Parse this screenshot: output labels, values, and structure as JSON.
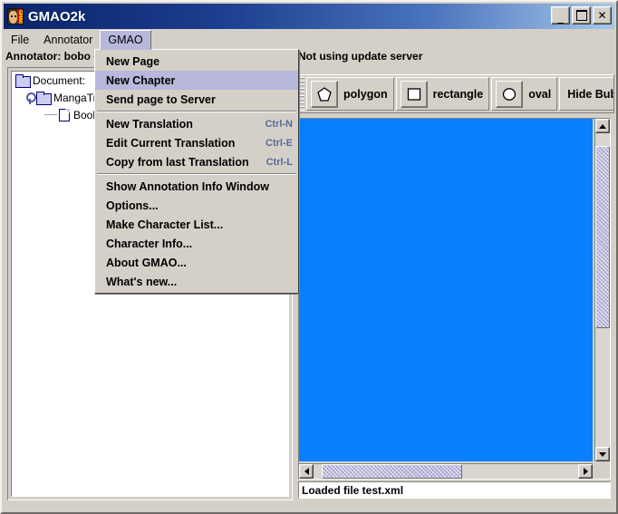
{
  "window": {
    "title": "GMAO2k",
    "icon": "gmao-app-icon",
    "controls": {
      "minimize": "_",
      "maximize": "□",
      "close": "✕"
    }
  },
  "menubar": {
    "items": [
      {
        "label": "File",
        "open": false
      },
      {
        "label": "Annotator",
        "open": false
      },
      {
        "label": "GMAO",
        "open": true
      }
    ]
  },
  "dropdown": {
    "owner": "GMAO",
    "items": [
      {
        "label": "New Page",
        "accel": "",
        "selected": false,
        "type": "item"
      },
      {
        "label": "New Chapter",
        "accel": "",
        "selected": true,
        "type": "item"
      },
      {
        "label": "Send page to Server",
        "accel": "",
        "selected": false,
        "type": "item"
      },
      {
        "type": "separator"
      },
      {
        "label": "New Translation",
        "accel": "Ctrl-N",
        "selected": false,
        "type": "item"
      },
      {
        "label": "Edit Current Translation",
        "accel": "Ctrl-E",
        "selected": false,
        "type": "item"
      },
      {
        "label": "Copy from last Translation",
        "accel": "Ctrl-L",
        "selected": false,
        "type": "item"
      },
      {
        "type": "separator"
      },
      {
        "label": "Show Annotation Info Window",
        "accel": "",
        "selected": false,
        "type": "item"
      },
      {
        "label": "Options...",
        "accel": "",
        "selected": false,
        "type": "item"
      },
      {
        "label": "Make Character List...",
        "accel": "",
        "selected": false,
        "type": "item"
      },
      {
        "label": "Character Info...",
        "accel": "",
        "selected": false,
        "type": "item"
      },
      {
        "label": "About GMAO...",
        "accel": "",
        "selected": false,
        "type": "item"
      },
      {
        "label": "What's new...",
        "accel": "",
        "selected": false,
        "type": "item"
      }
    ]
  },
  "annotator": {
    "text": "Annotator: bobo (b"
  },
  "update_server": {
    "text": "Not using update server"
  },
  "tree": {
    "rows": [
      {
        "label": "Document:",
        "icon": "folder-icon",
        "level": 0,
        "handle": "none"
      },
      {
        "label": "MangaTr",
        "icon": "folder-icon",
        "level": 1,
        "handle": "expanded"
      },
      {
        "label": "Book",
        "icon": "page-icon",
        "level": 2,
        "handle": "leaf"
      }
    ]
  },
  "toolbar": {
    "buttons": [
      {
        "label": "polygon",
        "icon": "polygon-icon"
      },
      {
        "label": "rectangle",
        "icon": "rectangle-icon"
      },
      {
        "label": "oval",
        "icon": "oval-icon"
      },
      {
        "label": "Hide Bubl",
        "icon": "none"
      }
    ]
  },
  "canvas": {
    "fill_color": "#0880fe"
  },
  "scrollbars": {
    "vertical": {
      "thumb_top_pct": 4,
      "thumb_height_pct": 58
    },
    "horizontal": {
      "thumb_left_pct": 3,
      "thumb_width_pct": 53
    }
  },
  "status": {
    "text": "Loaded file test.xml"
  },
  "colors": {
    "face": "#d4d0c8",
    "title_start": "#0a246a",
    "title_end": "#a6c8ea",
    "menu_highlight": "#b8b8dc",
    "canvas_blue": "#0880fe",
    "accel_text": "#5a6a9a"
  }
}
